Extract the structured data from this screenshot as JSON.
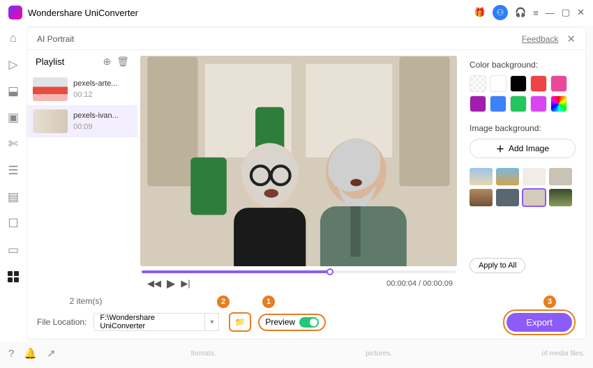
{
  "title": "Wondershare UniConverter",
  "panel": {
    "name": "AI Portrait",
    "feedback": "Feedback"
  },
  "playlist": {
    "label": "Playlist",
    "items": [
      {
        "name": "pexels-arte...",
        "duration": "00:12"
      },
      {
        "name": "pexels-ivan...",
        "duration": "00:09"
      }
    ],
    "count": "2 item(s)"
  },
  "player": {
    "time_current": "00:00:04",
    "time_total": "00:00:09"
  },
  "right": {
    "color_label": "Color background:",
    "colors": [
      "#ffffff00",
      "#ffffff",
      "#000000",
      "#ef4444",
      "#f97316",
      "#a21caf",
      "#3b82f6",
      "#22c55e",
      "#d946ef",
      "rainbow"
    ],
    "image_label": "Image background:",
    "add_image": "Add Image",
    "apply_all": "Apply to All"
  },
  "footer": {
    "file_location_label": "File Location:",
    "file_location_value": "F:\\Wondershare UniConverter",
    "preview_label": "Preview",
    "export": "Export"
  },
  "callouts": {
    "one": "1",
    "two": "2",
    "three": "3"
  },
  "fragments": {
    "a": "formats.",
    "b": "pictures.",
    "c": "of media files."
  }
}
